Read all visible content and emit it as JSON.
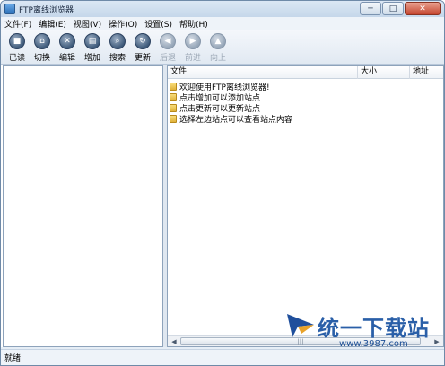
{
  "window": {
    "title": "FTP离线浏览器",
    "minimize_glyph": "─",
    "maximize_glyph": "□",
    "close_glyph": "✕"
  },
  "menu": [
    {
      "label": "文件(F)"
    },
    {
      "label": "编辑(E)"
    },
    {
      "label": "视图(V)"
    },
    {
      "label": "操作(O)"
    },
    {
      "label": "设置(S)"
    },
    {
      "label": "帮助(H)"
    }
  ],
  "toolbar": [
    {
      "label": "已读",
      "icon": "read-icon",
      "glyph": "■",
      "enabled": true
    },
    {
      "label": "切换",
      "icon": "switch-icon",
      "glyph": "⌂",
      "enabled": true
    },
    {
      "label": "编辑",
      "icon": "edit-icon",
      "glyph": "✕",
      "enabled": true
    },
    {
      "label": "增加",
      "icon": "add-icon",
      "glyph": "▤",
      "enabled": true
    },
    {
      "label": "搜索",
      "icon": "search-icon",
      "glyph": "⌕",
      "enabled": true
    },
    {
      "label": "更新",
      "icon": "refresh-icon",
      "glyph": "↻",
      "enabled": true
    },
    {
      "label": "后退",
      "icon": "back-icon",
      "glyph": "◀",
      "enabled": false
    },
    {
      "label": "前进",
      "icon": "forward-icon",
      "glyph": "▶",
      "enabled": false
    },
    {
      "label": "向上",
      "icon": "up-icon",
      "glyph": "▲",
      "enabled": false
    }
  ],
  "filelist": {
    "columns": [
      "文件",
      "大小",
      "地址"
    ],
    "rows": [
      {
        "name": "欢迎使用FTP离线浏览器!"
      },
      {
        "name": "点击增加可以添加站点"
      },
      {
        "name": "点击更新可以更新站点"
      },
      {
        "name": "选择左边站点可以查看站点内容"
      }
    ]
  },
  "scrollbar": {
    "left_glyph": "◀",
    "right_glyph": "▶",
    "thumb_grip": "|||"
  },
  "status": {
    "text": "就绪"
  },
  "watermark": {
    "brand": "统一下载站",
    "url": "www.3987.com"
  },
  "colors": {
    "accent": "#2a5fa8",
    "folder": "#e0b23a"
  }
}
